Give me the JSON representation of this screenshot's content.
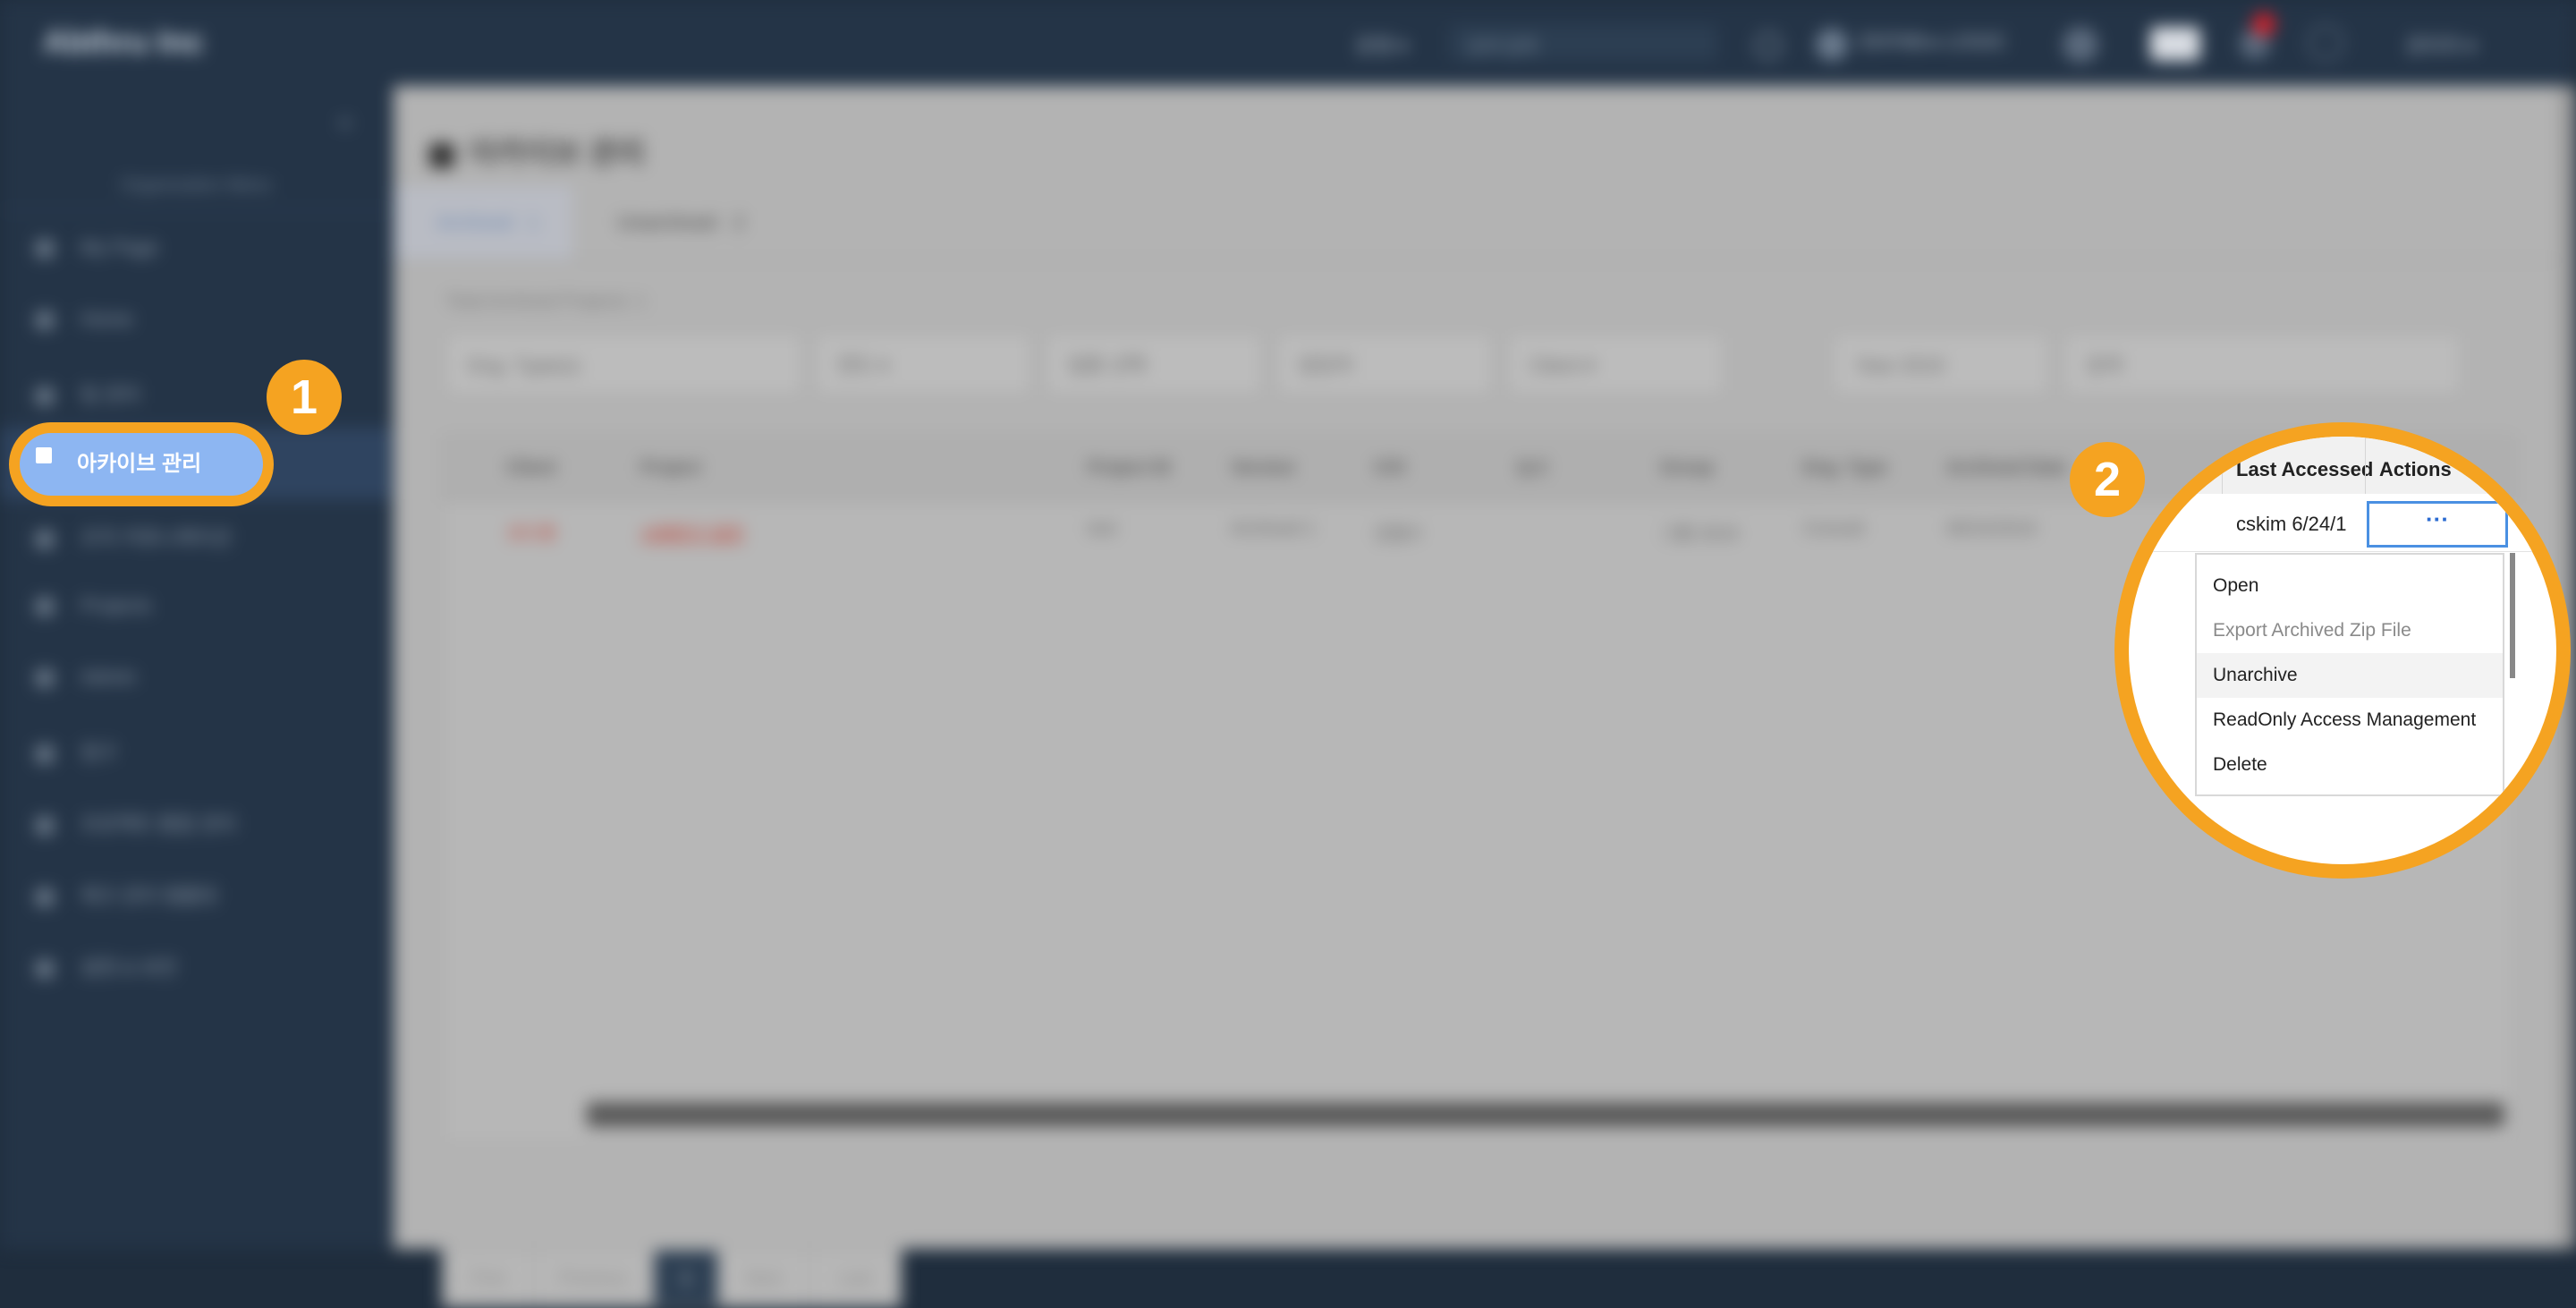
{
  "brand": {
    "name": "Abthru Inc"
  },
  "topbar": {
    "items": [
      "운영 ▾",
      "검색 입력",
      "ENTAB ▸ LOGIC",
      "관리자 ▾"
    ]
  },
  "sidebar": {
    "org_label": "Organization Menu",
    "items": [
      "My Page",
      "Home",
      "팀 관리",
      "아카이브 관리",
      "조직 커뮤니케이션",
      "Projects",
      "Admin",
      "청구",
      "프로젝트 통합 관리",
      "체크 관리 템플릿",
      "설정 & 보안"
    ],
    "active_label": "아카이브 관리"
  },
  "page": {
    "title": "아카이브 관리"
  },
  "tabs": {
    "archived": "Archived",
    "archived_count": "1",
    "unarchived": "Unarchived",
    "unarchived_count": "2"
  },
  "total_label": "Total Archived Projects: 1",
  "filters": [
    "Eng. Type(s)",
    "연도 ▾",
    "업종 선택",
    "담당자",
    "Client ▾",
    "Year 2019",
    "검색"
  ],
  "table": {
    "headers": [
      "Client",
      "Project",
      "Project ID",
      "Version",
      "C/O",
      "Q.C",
      "Group",
      "Eng. Type",
      "Archived Date",
      "Last Accessed",
      "Actions"
    ],
    "row": [
      "코드명",
      "사례연구 업무",
      "test",
      "Archived 1",
      "김철수",
      "",
      "그룹 2019",
      "Consult",
      "06/24/2019",
      "cskim 6/24/1"
    ]
  },
  "pagination": [
    "First",
    "Previous",
    "1",
    "Next",
    "Last"
  ],
  "callouts": {
    "badge1": "1",
    "badge2": "2"
  },
  "zoom": {
    "headers": {
      "last_accessed": "Last Accessed",
      "actions": "Actions"
    },
    "cell": "cskim 6/24/1",
    "actions_glyph": "···",
    "menu": [
      "Open",
      "Export Archived Zip File",
      "Unarchive",
      "ReadOnly Access Management",
      "Delete"
    ],
    "disabled_item": "Export Archived Zip File",
    "hover_item": "Unarchive"
  },
  "colors": {
    "highlight_orange": "#f5a321",
    "active_blue": "#8db6f2",
    "action_blue": "#4a90e2",
    "sidebar_bg": "#243447"
  }
}
